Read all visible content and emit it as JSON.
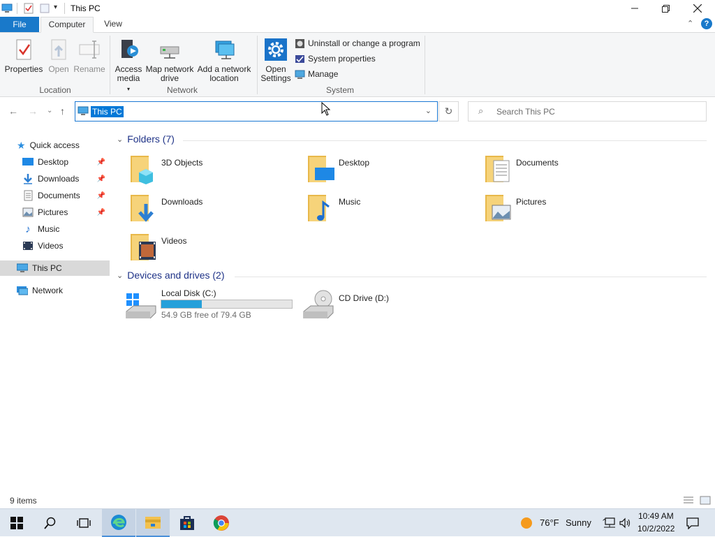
{
  "window": {
    "title": "This PC"
  },
  "ribbon_tabs": {
    "file": "File",
    "computer": "Computer",
    "view": "View"
  },
  "ribbon": {
    "location": {
      "label": "Location",
      "properties": "Properties",
      "open": "Open",
      "rename": "Rename"
    },
    "network": {
      "label": "Network",
      "access_media": "Access media",
      "map_drive": "Map network drive",
      "add_location_1": "Add a network",
      "add_location_2": "location"
    },
    "system": {
      "label": "System",
      "open_settings_1": "Open",
      "open_settings_2": "Settings",
      "uninstall": "Uninstall or change a program",
      "system_properties": "System properties",
      "manage": "Manage"
    }
  },
  "address": {
    "path": "This PC",
    "search_placeholder": "Search This PC"
  },
  "sidebar": {
    "quick_access": "Quick access",
    "items": [
      {
        "label": "Desktop",
        "pinned": true
      },
      {
        "label": "Downloads",
        "pinned": true
      },
      {
        "label": "Documents",
        "pinned": true
      },
      {
        "label": "Pictures",
        "pinned": true
      },
      {
        "label": "Music",
        "pinned": false
      },
      {
        "label": "Videos",
        "pinned": false
      }
    ],
    "this_pc": "This PC",
    "network": "Network"
  },
  "folders_header": "Folders (7)",
  "folders": [
    "3D Objects",
    "Desktop",
    "Documents",
    "Downloads",
    "Music",
    "Pictures",
    "Videos"
  ],
  "devices_header": "Devices and drives (2)",
  "drives": [
    {
      "name": "Local Disk (C:)",
      "free": "54.9 GB free of 79.4 GB",
      "used_fraction": 0.31
    },
    {
      "name": "CD Drive (D:)"
    }
  ],
  "status": {
    "items": "9 items"
  },
  "taskbar": {
    "weather_temp": "76°F",
    "weather_desc": "Sunny",
    "time": "10:49 AM",
    "date": "10/2/2022"
  },
  "colors": {
    "accent": "#1979ca",
    "selection": "#0078d7",
    "folder": "#f4c95d",
    "drive_bar": "#26a0da"
  }
}
